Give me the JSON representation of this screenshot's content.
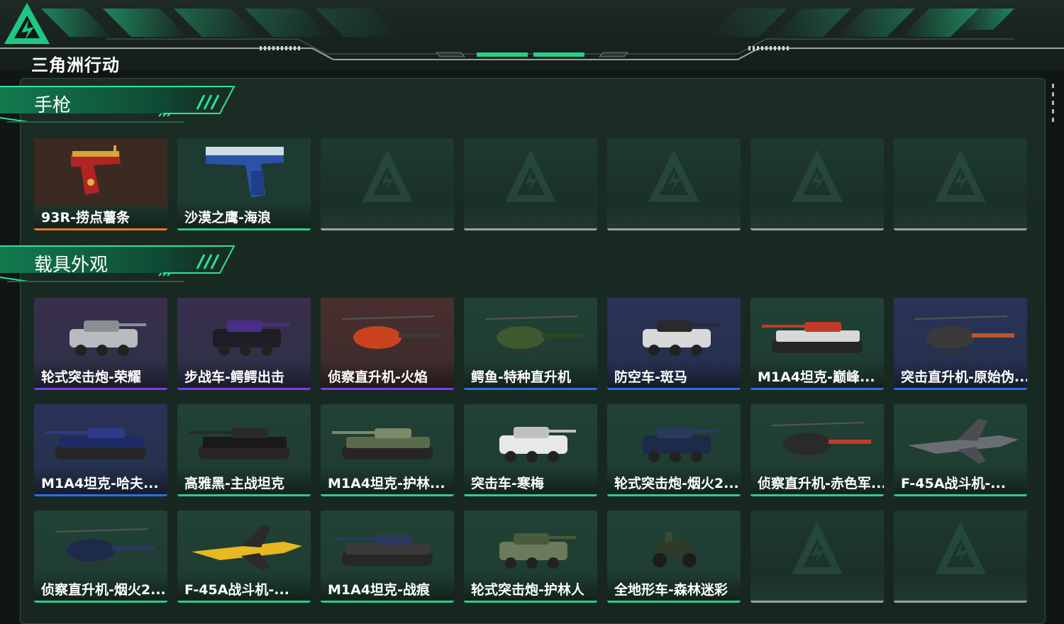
{
  "app": {
    "title": "三角洲行动"
  },
  "colors": {
    "orange": "#e87a2a",
    "green": "#2ccf85",
    "purple": "#7b3fe4",
    "blue": "#2f6fe0",
    "gray": "#9aa3a0",
    "accent": "#18c07a"
  },
  "sections": [
    {
      "title": "手枪"
    },
    {
      "title": "载具外观"
    }
  ],
  "pistols": [
    {
      "label": "93R-捞点薯条",
      "rarity": "orange"
    },
    {
      "label": "沙漠之鹰-海浪",
      "rarity": "green"
    },
    {
      "label": "",
      "rarity": "gray"
    },
    {
      "label": "",
      "rarity": "gray"
    },
    {
      "label": "",
      "rarity": "gray"
    },
    {
      "label": "",
      "rarity": "gray"
    },
    {
      "label": "",
      "rarity": "gray"
    }
  ],
  "vehicles": [
    {
      "label": "轮式突击炮-荣耀",
      "rarity": "purple"
    },
    {
      "label": "步战车-鳄鳄出击",
      "rarity": "purple"
    },
    {
      "label": "侦察直升机-火焰",
      "rarity": "purple"
    },
    {
      "label": "鳄鱼-特种直升机",
      "rarity": "blue"
    },
    {
      "label": "防空车-斑马",
      "rarity": "blue"
    },
    {
      "label": "M1A4坦克-巅峰...",
      "rarity": "blue"
    },
    {
      "label": "突击直升机-原始伪...",
      "rarity": "blue"
    },
    {
      "label": "M1A4坦克-哈夫...",
      "rarity": "blue"
    },
    {
      "label": "高雅黑-主战坦克",
      "rarity": "green"
    },
    {
      "label": "M1A4坦克-护林...",
      "rarity": "green"
    },
    {
      "label": "突击车-寒梅",
      "rarity": "green"
    },
    {
      "label": "轮式突击炮-烟火2...",
      "rarity": "green"
    },
    {
      "label": "侦察直升机-赤色军...",
      "rarity": "green"
    },
    {
      "label": "F-45A战斗机-...",
      "rarity": "green"
    },
    {
      "label": "侦察直升机-烟火2...",
      "rarity": "green"
    },
    {
      "label": "F-45A战斗机-...",
      "rarity": "green"
    },
    {
      "label": "M1A4坦克-战痕",
      "rarity": "green"
    },
    {
      "label": "轮式突击炮-护林人",
      "rarity": "green"
    },
    {
      "label": "全地形车-森林迷彩",
      "rarity": "green"
    },
    {
      "label": "",
      "rarity": "gray"
    },
    {
      "label": "",
      "rarity": "gray"
    }
  ]
}
